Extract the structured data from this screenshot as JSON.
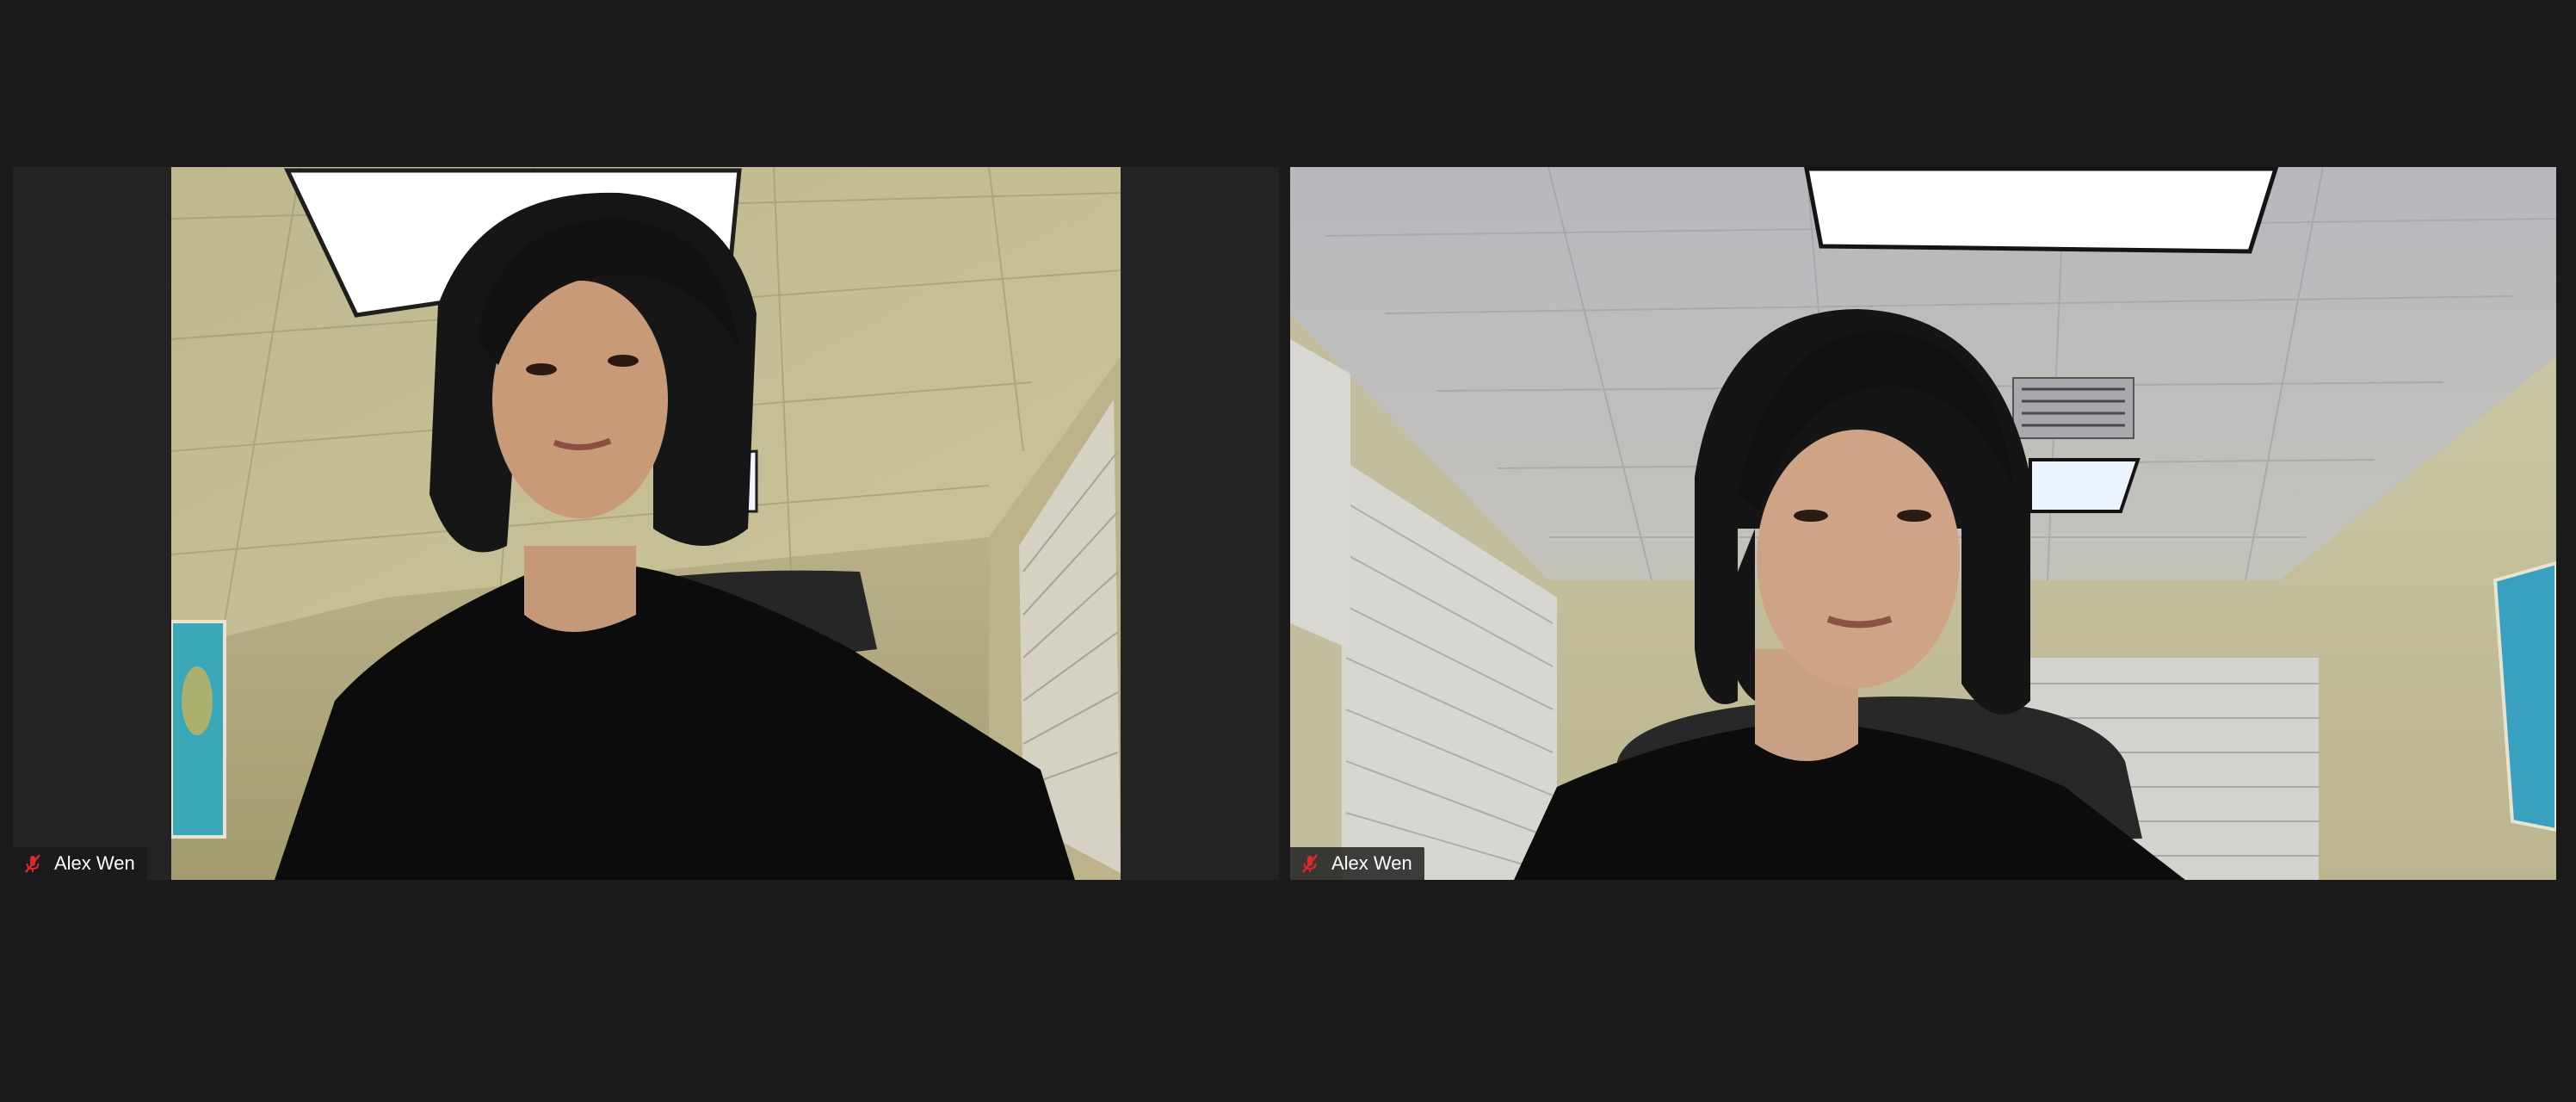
{
  "participants": [
    {
      "name": "Alex Wen",
      "mic_icon": "mic-muted-icon",
      "mic_color": "#e02828",
      "video_tone": "warm"
    },
    {
      "name": "Alex Wen",
      "mic_icon": "mic-muted-icon",
      "mic_color": "#e02828",
      "video_tone": "cool"
    }
  ],
  "colors": {
    "background": "#1a1a1a",
    "tile_background": "#232323",
    "name_text": "#ffffff"
  }
}
